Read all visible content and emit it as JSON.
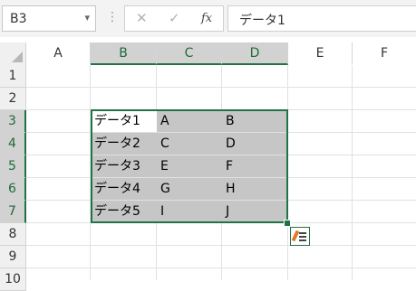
{
  "name_box": {
    "value": "B3",
    "dropdown_icon": "chevron-down-icon"
  },
  "formula_bar": {
    "cancel_glyph": "✕",
    "enter_glyph": "✓",
    "fx_label": "fx",
    "value": "データ1"
  },
  "columns": [
    "A",
    "B",
    "C",
    "D",
    "E",
    "F"
  ],
  "rows": [
    "1",
    "2",
    "3",
    "4",
    "5",
    "6",
    "7",
    "8",
    "9",
    "10"
  ],
  "selection": {
    "active_cell": "B3",
    "range": "B3:D7",
    "selected_columns": [
      "B",
      "C",
      "D"
    ],
    "selected_rows": [
      "3",
      "4",
      "5",
      "6",
      "7"
    ]
  },
  "cells": {
    "B3": "データ1",
    "C3": "A",
    "D3": "B",
    "B4": "データ2",
    "C4": "C",
    "D4": "D",
    "B5": "データ3",
    "C5": "E",
    "D5": "F",
    "B6": "データ4",
    "C6": "G",
    "D6": "H",
    "B7": "データ5",
    "C7": "I",
    "D7": "J"
  },
  "colors": {
    "accent": "#217346",
    "selection_fill": "#c6c6c6",
    "header_fill": "#f0f0f0"
  },
  "quick_analysis": {
    "icon": "quick-analysis-icon"
  }
}
